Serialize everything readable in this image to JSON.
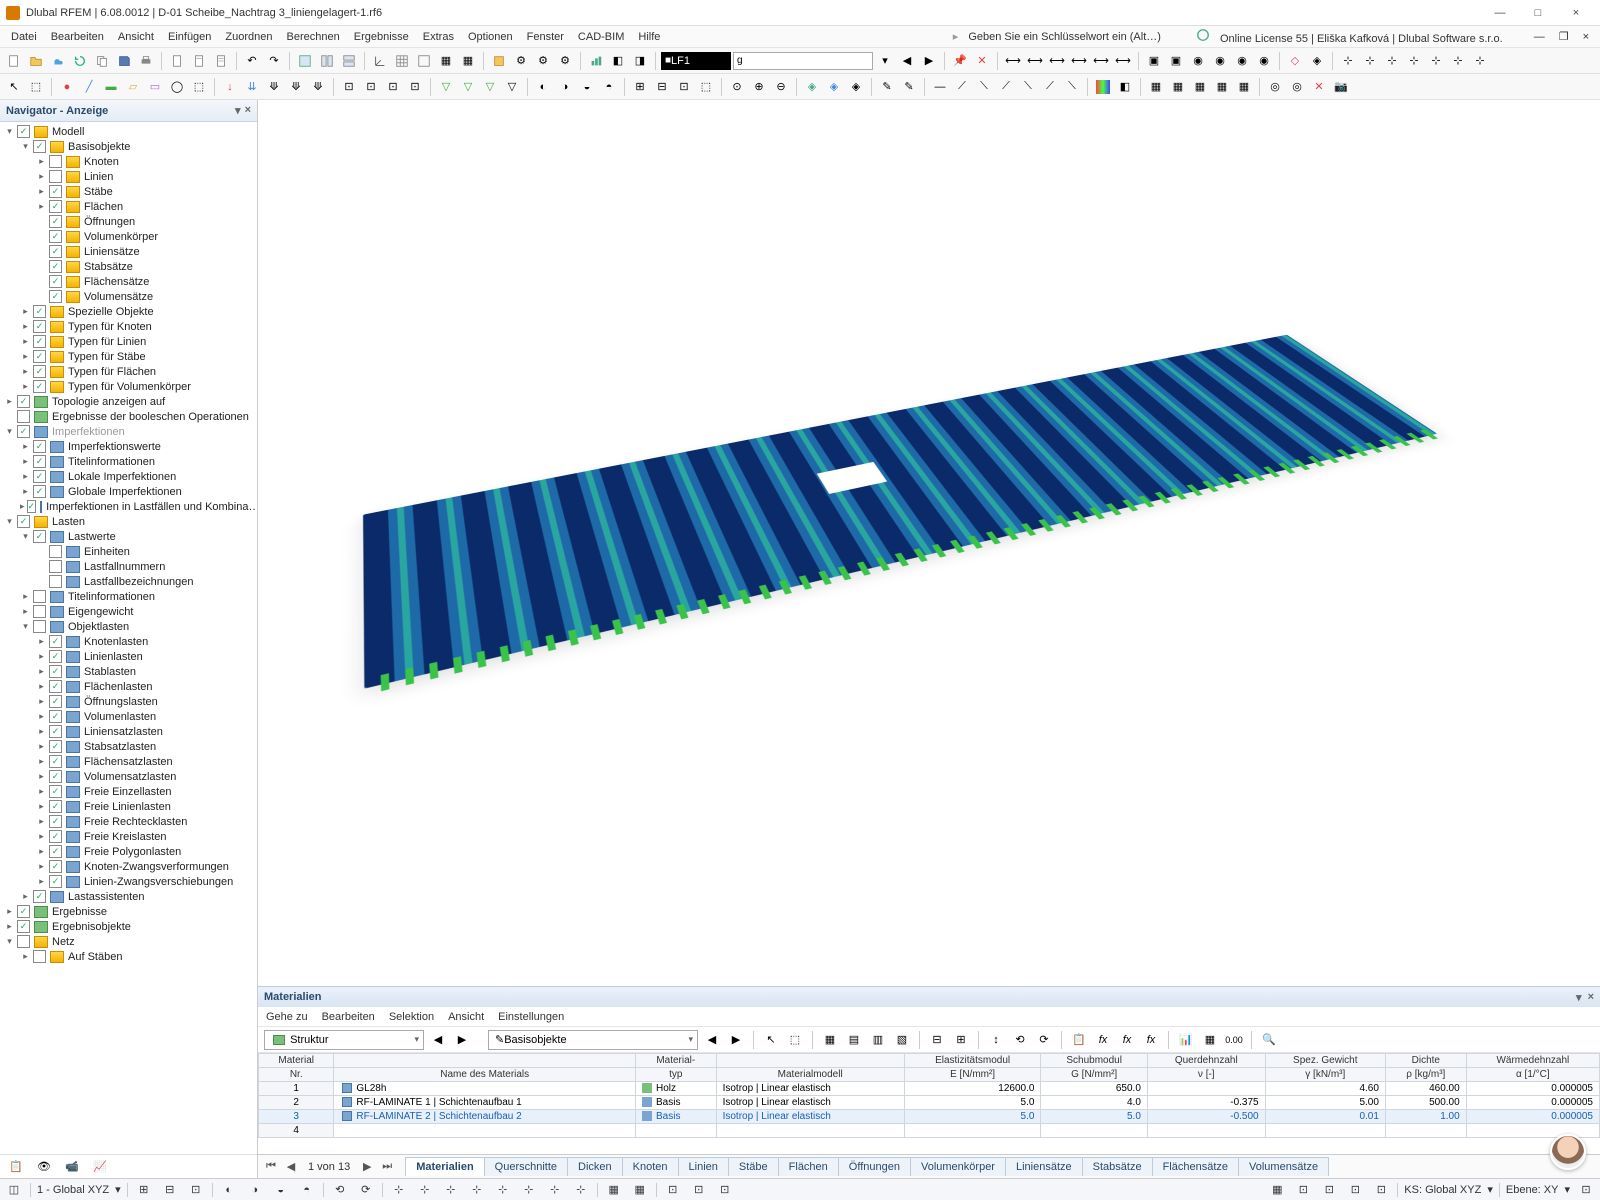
{
  "window": {
    "title": "Dlubal RFEM | 6.08.0012 | D-01 Scheibe_Nachtrag 3_liniengelagert-1.rf6",
    "win_min": "—",
    "win_max": "□",
    "win_close": "×"
  },
  "topextra": {
    "hint": "Geben Sie ein Schlüsselwort ein (Alt…)",
    "license": "Online License 55 | Eliška Kafková | Dlubal Software s.r.o.",
    "doc_min": "—",
    "doc_max": "❐",
    "doc_close": "×"
  },
  "menu": [
    "Datei",
    "Bearbeiten",
    "Ansicht",
    "Einfügen",
    "Zuordnen",
    "Berechnen",
    "Ergebnisse",
    "Extras",
    "Optionen",
    "Fenster",
    "CAD-BIM",
    "Hilfe"
  ],
  "lf": {
    "box": "LF1",
    "input": "g"
  },
  "navigator": {
    "title": "Navigator - Anzeige",
    "items": [
      {
        "d": 0,
        "a": "v",
        "c": 1,
        "i": "y",
        "l": "Modell"
      },
      {
        "d": 1,
        "a": "v",
        "c": 1,
        "i": "y",
        "l": "Basisobjekte"
      },
      {
        "d": 2,
        "a": ">",
        "c": 0,
        "i": "y",
        "l": "Knoten"
      },
      {
        "d": 2,
        "a": ">",
        "c": 0,
        "i": "y",
        "l": "Linien"
      },
      {
        "d": 2,
        "a": ">",
        "c": 1,
        "i": "y",
        "l": "Stäbe"
      },
      {
        "d": 2,
        "a": ">",
        "c": 1,
        "i": "y",
        "l": "Flächen"
      },
      {
        "d": 2,
        "a": "",
        "c": 1,
        "i": "y",
        "l": "Öffnungen"
      },
      {
        "d": 2,
        "a": "",
        "c": 1,
        "i": "y",
        "l": "Volumenkörper"
      },
      {
        "d": 2,
        "a": "",
        "c": 1,
        "i": "y",
        "l": "Liniensätze"
      },
      {
        "d": 2,
        "a": "",
        "c": 1,
        "i": "y",
        "l": "Stabsätze"
      },
      {
        "d": 2,
        "a": "",
        "c": 1,
        "i": "y",
        "l": "Flächensätze"
      },
      {
        "d": 2,
        "a": "",
        "c": 1,
        "i": "y",
        "l": "Volumensätze"
      },
      {
        "d": 1,
        "a": ">",
        "c": 1,
        "i": "y",
        "l": "Spezielle Objekte"
      },
      {
        "d": 1,
        "a": ">",
        "c": 1,
        "i": "y",
        "l": "Typen für Knoten"
      },
      {
        "d": 1,
        "a": ">",
        "c": 1,
        "i": "y",
        "l": "Typen für Linien"
      },
      {
        "d": 1,
        "a": ">",
        "c": 1,
        "i": "y",
        "l": "Typen für Stäbe"
      },
      {
        "d": 1,
        "a": ">",
        "c": 1,
        "i": "y",
        "l": "Typen für Flächen"
      },
      {
        "d": 1,
        "a": ">",
        "c": 1,
        "i": "y",
        "l": "Typen für Volumenkörper"
      },
      {
        "d": 0,
        "a": ">",
        "c": 1,
        "i": "g",
        "l": "Topologie anzeigen auf"
      },
      {
        "d": 0,
        "a": "",
        "c": 0,
        "i": "g",
        "l": "Ergebnisse der booleschen Operationen"
      },
      {
        "d": 0,
        "a": "v",
        "c": 1,
        "i": "b",
        "l": "Imperfektionen",
        "dim": 1
      },
      {
        "d": 1,
        "a": ">",
        "c": 1,
        "i": "b",
        "l": "Imperfektionswerte"
      },
      {
        "d": 1,
        "a": ">",
        "c": 1,
        "i": "b",
        "l": "Titelinformationen"
      },
      {
        "d": 1,
        "a": ">",
        "c": 1,
        "i": "b",
        "l": "Lokale Imperfektionen"
      },
      {
        "d": 1,
        "a": ">",
        "c": 1,
        "i": "b",
        "l": "Globale Imperfektionen"
      },
      {
        "d": 1,
        "a": ">",
        "c": 1,
        "i": "b",
        "l": "Imperfektionen in Lastfällen und Kombina…"
      },
      {
        "d": 0,
        "a": "v",
        "c": 1,
        "i": "y",
        "l": "Lasten"
      },
      {
        "d": 1,
        "a": "v",
        "c": 1,
        "i": "b",
        "l": "Lastwerte"
      },
      {
        "d": 2,
        "a": "",
        "c": 0,
        "i": "b",
        "l": "Einheiten"
      },
      {
        "d": 2,
        "a": "",
        "c": 0,
        "i": "b",
        "l": "Lastfallnummern"
      },
      {
        "d": 2,
        "a": "",
        "c": 0,
        "i": "b",
        "l": "Lastfallbezeichnungen"
      },
      {
        "d": 1,
        "a": ">",
        "c": 0,
        "i": "b",
        "l": "Titelinformationen"
      },
      {
        "d": 1,
        "a": ">",
        "c": 0,
        "i": "b",
        "l": "Eigengewicht"
      },
      {
        "d": 1,
        "a": "v",
        "c": 0,
        "i": "b",
        "l": "Objektlasten"
      },
      {
        "d": 2,
        "a": ">",
        "c": 1,
        "i": "b",
        "l": "Knotenlasten"
      },
      {
        "d": 2,
        "a": ">",
        "c": 1,
        "i": "b",
        "l": "Linienlasten"
      },
      {
        "d": 2,
        "a": ">",
        "c": 1,
        "i": "b",
        "l": "Stablasten"
      },
      {
        "d": 2,
        "a": ">",
        "c": 1,
        "i": "b",
        "l": "Flächenlasten"
      },
      {
        "d": 2,
        "a": ">",
        "c": 1,
        "i": "b",
        "l": "Öffnungslasten"
      },
      {
        "d": 2,
        "a": ">",
        "c": 1,
        "i": "b",
        "l": "Volumenlasten"
      },
      {
        "d": 2,
        "a": ">",
        "c": 1,
        "i": "b",
        "l": "Liniensatzlasten"
      },
      {
        "d": 2,
        "a": ">",
        "c": 1,
        "i": "b",
        "l": "Stabsatzlasten"
      },
      {
        "d": 2,
        "a": ">",
        "c": 1,
        "i": "b",
        "l": "Flächensatzlasten"
      },
      {
        "d": 2,
        "a": ">",
        "c": 1,
        "i": "b",
        "l": "Volumensatzlasten"
      },
      {
        "d": 2,
        "a": ">",
        "c": 1,
        "i": "b",
        "l": "Freie Einzellasten"
      },
      {
        "d": 2,
        "a": ">",
        "c": 1,
        "i": "b",
        "l": "Freie Linienlasten"
      },
      {
        "d": 2,
        "a": ">",
        "c": 1,
        "i": "b",
        "l": "Freie Rechtecklasten"
      },
      {
        "d": 2,
        "a": ">",
        "c": 1,
        "i": "b",
        "l": "Freie Kreislasten"
      },
      {
        "d": 2,
        "a": ">",
        "c": 1,
        "i": "b",
        "l": "Freie Polygonlasten"
      },
      {
        "d": 2,
        "a": ">",
        "c": 1,
        "i": "b",
        "l": "Knoten-Zwangsverformungen"
      },
      {
        "d": 2,
        "a": ">",
        "c": 1,
        "i": "b",
        "l": "Linien-Zwangsverschiebungen"
      },
      {
        "d": 1,
        "a": ">",
        "c": 1,
        "i": "b",
        "l": "Lastassistenten"
      },
      {
        "d": 0,
        "a": ">",
        "c": 1,
        "i": "g",
        "l": "Ergebnisse"
      },
      {
        "d": 0,
        "a": ">",
        "c": 1,
        "i": "g",
        "l": "Ergebnisobjekte"
      },
      {
        "d": 0,
        "a": "v",
        "c": 0,
        "i": "y",
        "l": "Netz"
      },
      {
        "d": 1,
        "a": ">",
        "c": 0,
        "i": "y",
        "l": "Auf Stäben"
      }
    ]
  },
  "materials": {
    "title": "Materialien",
    "menu": [
      "Gehe zu",
      "Bearbeiten",
      "Selektion",
      "Ansicht",
      "Einstellungen"
    ],
    "combo1": "Struktur",
    "combo2": "Basisobjekte",
    "headers_top": [
      "Material",
      "",
      "Material-",
      "",
      "Elastizitätsmodul",
      "Schubmodul",
      "Querdehnzahl",
      "Spez. Gewicht",
      "Dichte",
      "Wärmedehnzahl"
    ],
    "headers_bot": [
      "Nr.",
      "Name des Materials",
      "typ",
      "Materialmodell",
      "E [N/mm²]",
      "G [N/mm²]",
      "ν [-]",
      "γ [kN/m³]",
      "ρ [kg/m³]",
      "α [1/°C]"
    ],
    "rows": [
      {
        "nr": "1",
        "name": "GL28h",
        "typ": "Holz",
        "modell": "Isotrop | Linear elastisch",
        "E": "12600.0",
        "G": "650.0",
        "v": "",
        "y": "4.60",
        "p": "460.00",
        "a": "0.000005"
      },
      {
        "nr": "2",
        "name": "RF-LAMINATE 1 | Schichtenaufbau 1",
        "typ": "Basis",
        "modell": "Isotrop | Linear elastisch",
        "E": "5.0",
        "G": "4.0",
        "v": "-0.375",
        "y": "5.00",
        "p": "500.00",
        "a": "0.000005"
      },
      {
        "nr": "3",
        "name": "RF-LAMINATE 2 | Schichtenaufbau 2",
        "typ": "Basis",
        "modell": "Isotrop | Linear elastisch",
        "E": "5.0",
        "G": "5.0",
        "v": "-0.500",
        "y": "0.01",
        "p": "1.00",
        "a": "0.000005",
        "sel": 1
      },
      {
        "nr": "4",
        "name": "",
        "typ": "",
        "modell": "",
        "E": "",
        "G": "",
        "v": "",
        "y": "",
        "p": "",
        "a": ""
      }
    ],
    "page": "1 von 13",
    "tabs": [
      "Materialien",
      "Querschnitte",
      "Dicken",
      "Knoten",
      "Linien",
      "Stäbe",
      "Flächen",
      "Öffnungen",
      "Volumenkörper",
      "Liniensätze",
      "Stabsätze",
      "Flächensätze",
      "Volumensätze"
    ]
  },
  "status": {
    "cs": "1 - Global XYZ",
    "ks": "KS: Global XYZ",
    "ebene": "Ebene: XY"
  }
}
